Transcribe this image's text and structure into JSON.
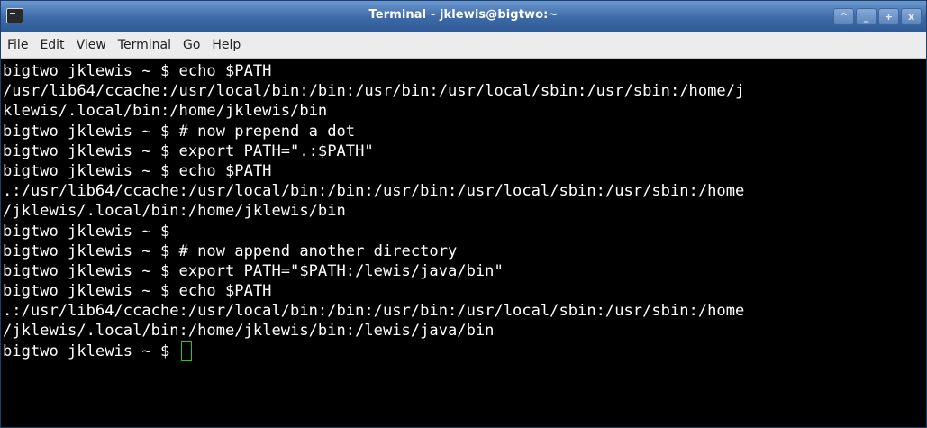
{
  "window": {
    "title": "Terminal - jklewis@bigtwo:~",
    "buttons": [
      {
        "name": "roll-up-button",
        "glyph": "^"
      },
      {
        "name": "minimize-button",
        "glyph": "_"
      },
      {
        "name": "maximize-button",
        "glyph": "+"
      },
      {
        "name": "close-button",
        "glyph": "x"
      }
    ]
  },
  "menu": {
    "items": [
      "File",
      "Edit",
      "View",
      "Terminal",
      "Go",
      "Help"
    ]
  },
  "terminal": {
    "lines": [
      "bigtwo jklewis ~ $ echo $PATH",
      "/usr/lib64/ccache:/usr/local/bin:/bin:/usr/bin:/usr/local/sbin:/usr/sbin:/home/j",
      "klewis/.local/bin:/home/jklewis/bin",
      "bigtwo jklewis ~ $ # now prepend a dot",
      "bigtwo jklewis ~ $ export PATH=\".:$PATH\"",
      "bigtwo jklewis ~ $ echo $PATH",
      ".:/usr/lib64/ccache:/usr/local/bin:/bin:/usr/bin:/usr/local/sbin:/usr/sbin:/home",
      "/jklewis/.local/bin:/home/jklewis/bin",
      "bigtwo jklewis ~ $",
      "bigtwo jklewis ~ $ # now append another directory",
      "bigtwo jklewis ~ $ export PATH=\"$PATH:/lewis/java/bin\"",
      "bigtwo jklewis ~ $ echo $PATH",
      ".:/usr/lib64/ccache:/usr/local/bin:/bin:/usr/bin:/usr/local/sbin:/usr/sbin:/home",
      "/jklewis/.local/bin:/home/jklewis/bin:/lewis/java/bin",
      "bigtwo jklewis ~ $ "
    ],
    "colors": {
      "background": "#000000",
      "foreground": "#ffffff",
      "cursor": "#18d118",
      "titlebar": "#4a77b4"
    }
  }
}
